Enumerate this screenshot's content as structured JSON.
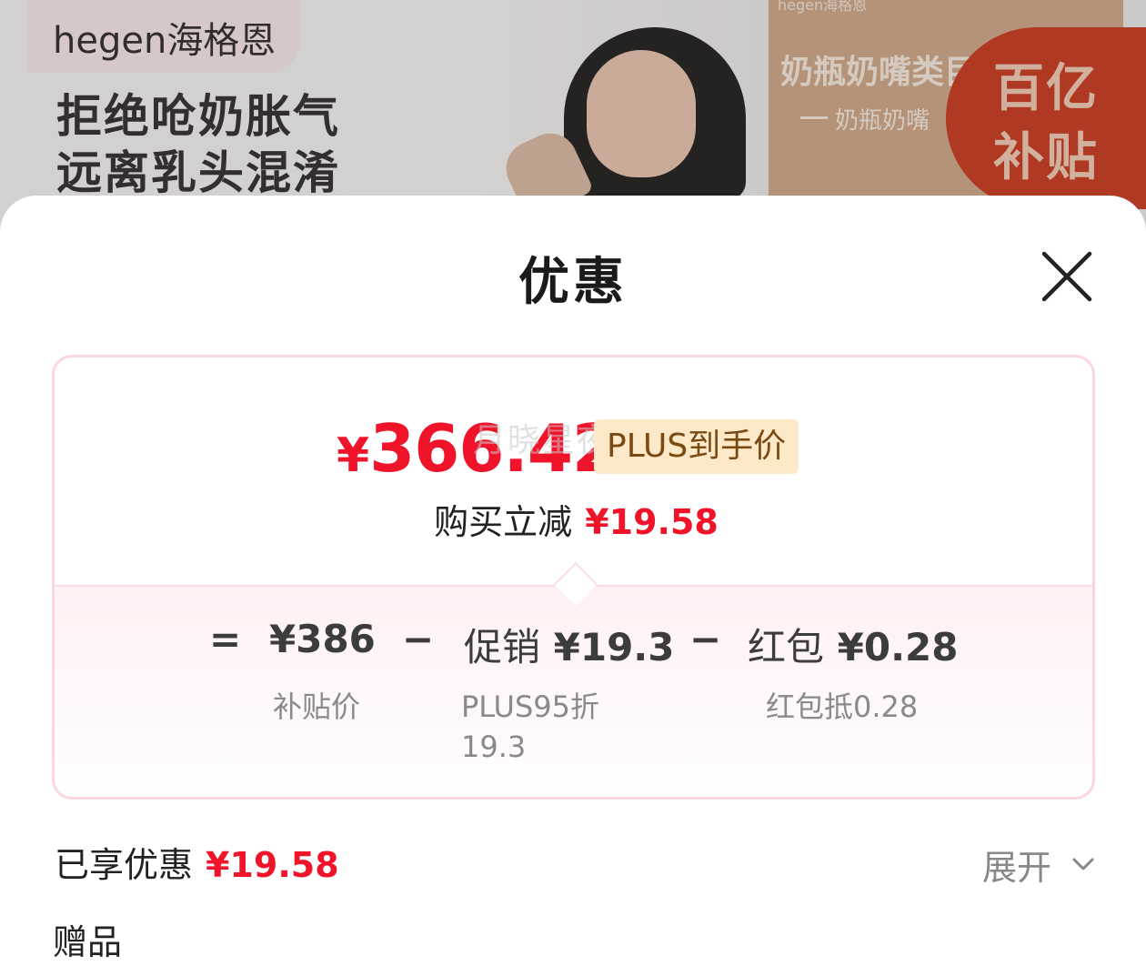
{
  "banner": {
    "brand": "hegen海格恩",
    "slogan_line1": "拒绝呛奶胀气",
    "slogan_line2": "远离乳头混淆",
    "right_small": "hegen海格恩",
    "right_title": "奶瓶奶嘴类目",
    "right_sub": "奶瓶奶嘴",
    "badge_line1": "百亿",
    "badge_line2": "补贴"
  },
  "sheet": {
    "title": "优惠",
    "close_icon": "close-icon"
  },
  "price": {
    "currency": "¥",
    "final_amount": "366.42",
    "plus_tag": "PLUS到手价",
    "watermark": "月晓星夜",
    "instant_label": "购买立减",
    "instant_value": "¥19.58"
  },
  "breakdown": {
    "equals": "=",
    "base_value": "¥386",
    "base_sub": "补贴价",
    "minus1": "−",
    "promo_label": "促销",
    "promo_value": "¥19.3",
    "promo_sub1": "PLUS95折",
    "promo_sub2": "19.3",
    "minus2": "−",
    "redpack_label": "红包",
    "redpack_value": "¥0.28",
    "redpack_sub": "红包抵0.28"
  },
  "summary": {
    "enjoyed_label": "已享优惠",
    "enjoyed_value": "¥19.58",
    "expand_label": "展开",
    "gift_label": "赠品"
  },
  "colors": {
    "accent_red": "#f0142b",
    "plus_tag_bg": "#fde9c8",
    "card_border": "#f9d7dd"
  }
}
